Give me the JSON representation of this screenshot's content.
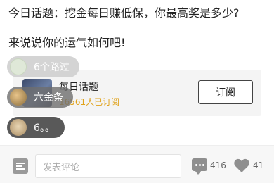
{
  "post": {
    "title": "今日话题：挖金每日赚低保，你最高奖是多少?",
    "body": "来说说你的运气如何吧!"
  },
  "topic_card": {
    "name": "每日话题",
    "subscribers": "16561人已订阅",
    "subscribe_label": "订阅"
  },
  "danmaku": [
    {
      "text": "6个路过"
    },
    {
      "text": "六金条"
    },
    {
      "text": "6。。"
    }
  ],
  "bottom_bar": {
    "comment_placeholder": "发表评论",
    "comment_count": "416",
    "like_count": "41"
  },
  "icons": {
    "menu": "list-icon",
    "comment": "comment-bubble-icon",
    "like": "heart-icon"
  }
}
